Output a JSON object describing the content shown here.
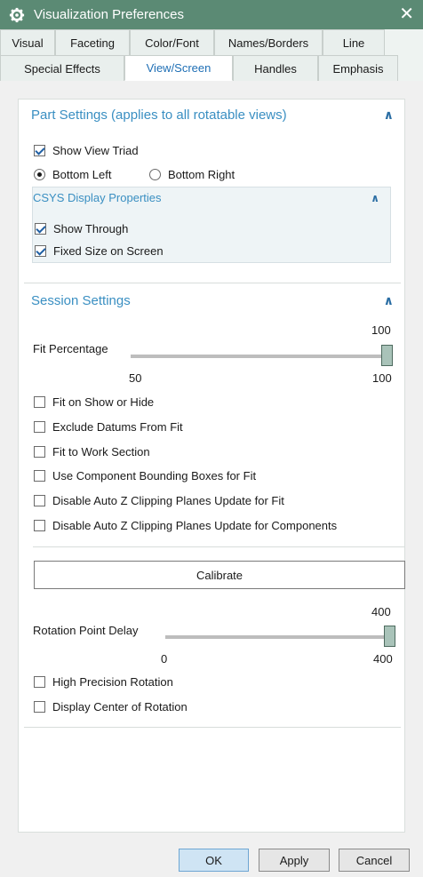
{
  "window": {
    "title": "Visualization Preferences"
  },
  "tabs": {
    "row1": [
      "Visual",
      "Faceting",
      "Color/Font",
      "Names/Borders",
      "Line"
    ],
    "row2": [
      "Special Effects",
      "View/Screen",
      "Handles",
      "Emphasis"
    ],
    "active": "View/Screen"
  },
  "part": {
    "header": "Part Settings (applies to all rotatable views)",
    "show_view_triad": {
      "label": "Show View Triad",
      "checked": true
    },
    "bottom_left": {
      "label": "Bottom Left",
      "selected": true
    },
    "bottom_right": {
      "label": "Bottom Right",
      "selected": false
    },
    "csys": {
      "header": "CSYS Display Properties",
      "show_through": {
        "label": "Show Through",
        "checked": true
      },
      "fixed_size": {
        "label": "Fixed Size on Screen",
        "checked": true
      }
    }
  },
  "session": {
    "header": "Session Settings",
    "fit": {
      "label": "Fit Percentage",
      "value": "100",
      "min": "50",
      "max": "100"
    },
    "checks": [
      {
        "label": "Fit on Show or Hide",
        "checked": false
      },
      {
        "label": "Exclude Datums From Fit",
        "checked": false
      },
      {
        "label": "Fit to Work Section",
        "checked": false
      },
      {
        "label": "Use Component Bounding Boxes for Fit",
        "checked": false
      },
      {
        "label": "Disable Auto Z Clipping Planes Update for Fit",
        "checked": false
      },
      {
        "label": "Disable Auto Z Clipping Planes Update for Components",
        "checked": false
      }
    ],
    "calibrate_label": "Calibrate",
    "rotation": {
      "label": "Rotation Point Delay",
      "value": "400",
      "min": "0",
      "max": "400"
    },
    "high_precision": {
      "label": "High Precision Rotation",
      "checked": false
    },
    "display_center": {
      "label": "Display Center of Rotation",
      "checked": false
    }
  },
  "footer": {
    "ok": "OK",
    "apply": "Apply",
    "cancel": "Cancel"
  },
  "colors": {
    "titlebar": "#5b8a74",
    "accent": "#3a8fc2",
    "active_tab_text": "#1f6fb5"
  }
}
